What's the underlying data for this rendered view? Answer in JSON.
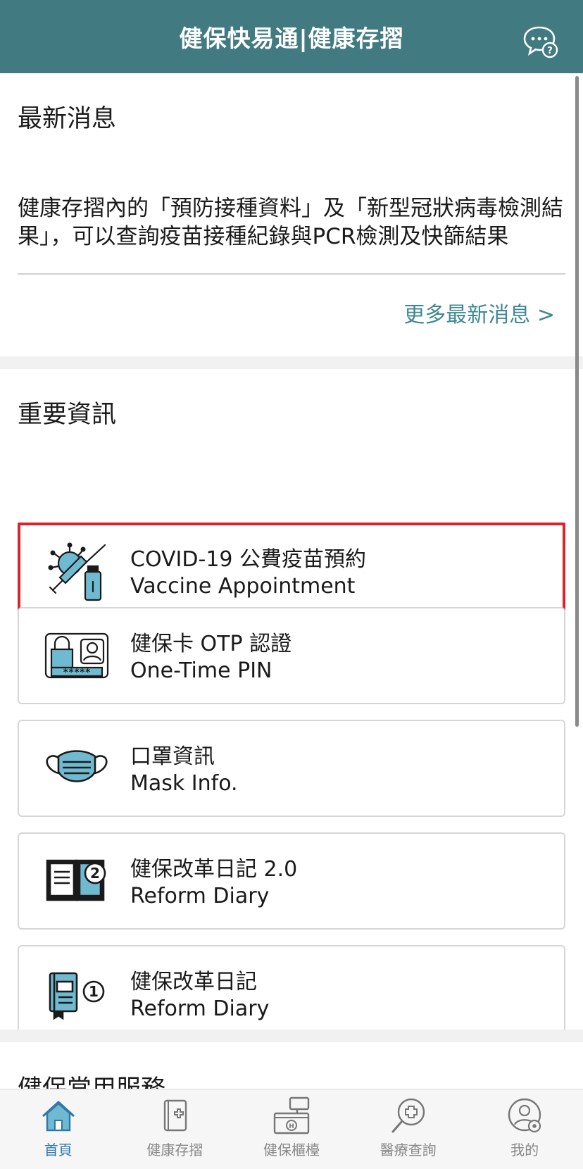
{
  "header": {
    "title": "健保快易通|健康存摺",
    "chat_icon": "chat-help-icon"
  },
  "news": {
    "title": "最新消息",
    "body": " 健康存摺內的「預防接種資料」及「新型冠狀病毒檢測結果」，可以查詢疫苗接種紀錄與PCR檢測及快篩結果",
    "more_link": "更多最新消息 >"
  },
  "important": {
    "title": "重要資訊",
    "cards": [
      {
        "line1": "COVID-19 公費疫苗預約",
        "line2": "Vaccine Appointment",
        "icon": "vaccine-icon",
        "highlighted": true
      },
      {
        "line1": "健保卡 OTP 認證",
        "line2": "One-Time PIN",
        "icon": "otp-lock-icon"
      },
      {
        "line1": "口罩資訊",
        "line2": "Mask Info.",
        "icon": "mask-icon"
      },
      {
        "line1": "健保改革日記 2.0",
        "line2": "Reform Diary",
        "icon": "diary-2-icon"
      },
      {
        "line1": "健保改革日記",
        "line2": "Reform Diary",
        "icon": "diary-1-icon"
      }
    ]
  },
  "common": {
    "title": "健保常用服務"
  },
  "tabbar": {
    "items": [
      {
        "label": "首頁",
        "icon": "home-icon",
        "active": true
      },
      {
        "label": "健康存摺",
        "icon": "health-book-icon"
      },
      {
        "label": "健保櫃檯",
        "icon": "counter-icon"
      },
      {
        "label": "醫療查詢",
        "icon": "medical-search-icon"
      },
      {
        "label": "我的",
        "icon": "profile-settings-icon"
      }
    ]
  },
  "colors": {
    "header_bg": "#427a82",
    "accent": "#3f8891",
    "highlight_border": "#d9232e",
    "tab_active": "#2f78a8",
    "icon_fill": "#6fbad0"
  }
}
